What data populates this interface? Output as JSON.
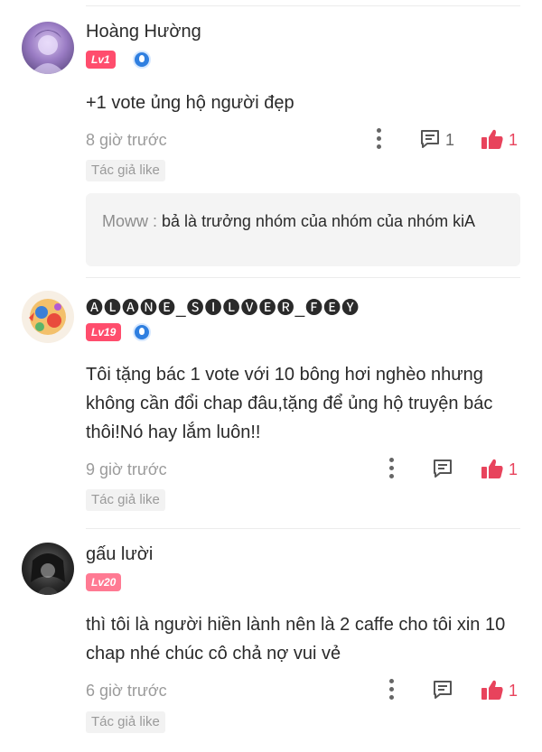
{
  "comments": [
    {
      "name": "Hoàng Hường",
      "level": "Lv1",
      "text": "+1 vote ủng hộ người đẹp",
      "time": "8 giờ trước",
      "reply_count": "1",
      "like_count": "1",
      "tag": "Tác giả like",
      "quote": {
        "author": "Moww",
        "separator": " : ",
        "text": "bả là trưởng nhóm của nhóm của nhóm kiA"
      }
    },
    {
      "name": "🅐🅛🅐🅝🅔_🅢🅘🅛🅥🅔🅡_🅕🅔🅨",
      "level": "Lv19",
      "text": "Tôi tặng bác 1 vote với 10 bông hơi nghèo nhưng không cần đổi chap đâu,tặng để ủng hộ truyện bác thôi!Nó hay lắm luôn!!",
      "time": "9 giờ trước",
      "like_count": "1",
      "tag": "Tác giả like"
    },
    {
      "name": "gấu lười",
      "level": "Lv20",
      "text": "thì tôi là người hiền lành nên là 2 caffe cho tôi xin 10 chap nhé chúc cô chả nợ vui vẻ",
      "time": "6 giờ trước",
      "like_count": "1",
      "tag": "Tác giả like"
    }
  ],
  "colors": {
    "accent": "#e8435c",
    "level_badge": "#ff4d6d",
    "verified": "#2f7fe0"
  },
  "icons": [
    "more-vertical-icon",
    "comment-reply-icon",
    "thumbs-up-icon",
    "verified-badge-icon"
  ]
}
